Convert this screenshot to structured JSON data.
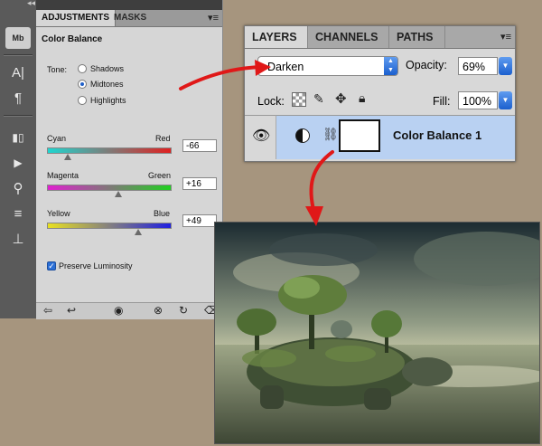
{
  "adjustments_panel": {
    "tabs": [
      {
        "label": "ADJUSTMENTS"
      },
      {
        "label": "MASKS"
      }
    ],
    "title": "Color Balance",
    "tone_label": "Tone:",
    "tone_options": [
      {
        "label": "Shadows",
        "selected": false
      },
      {
        "label": "Midtones",
        "selected": true
      },
      {
        "label": "Highlights",
        "selected": false
      }
    ],
    "sliders": [
      {
        "left_label": "Cyan",
        "right_label": "Red",
        "value": "-66",
        "colors": [
          "#1fd6d0",
          "#e02020"
        ]
      },
      {
        "left_label": "Magenta",
        "right_label": "Green",
        "value": "+16",
        "colors": [
          "#e020d0",
          "#20d020"
        ]
      },
      {
        "left_label": "Yellow",
        "right_label": "Blue",
        "value": "+49",
        "colors": [
          "#e8e020",
          "#2020e0"
        ]
      }
    ],
    "preserve_luminosity": {
      "label": "Preserve Luminosity",
      "checked": true
    },
    "tool_icons": [
      "mb-icon",
      "type-icon",
      "paragraph-icon",
      "brush-settings-icon",
      "play-icon",
      "clone-icon",
      "sliders-icon",
      "stamp-icon"
    ],
    "bottom_icons": [
      "back-arrow-icon",
      "return-icon",
      "eye-icon",
      "link-icon",
      "reset-icon",
      "trash-icon"
    ]
  },
  "layers_panel": {
    "tabs": [
      {
        "label": "LAYERS"
      },
      {
        "label": "CHANNELS"
      },
      {
        "label": "PATHS"
      }
    ],
    "blend_mode": "Darken",
    "opacity_label": "Opacity:",
    "opacity_value": "69%",
    "lock_label": "Lock:",
    "fill_label": "Fill:",
    "fill_value": "100%",
    "layer": {
      "name": "Color Balance 1"
    }
  },
  "colors": {
    "background": "#a6957e",
    "accent_blue": "#2b6fd6",
    "arrow_red": "#e01818",
    "selected_layer": "#b9d1f2"
  }
}
